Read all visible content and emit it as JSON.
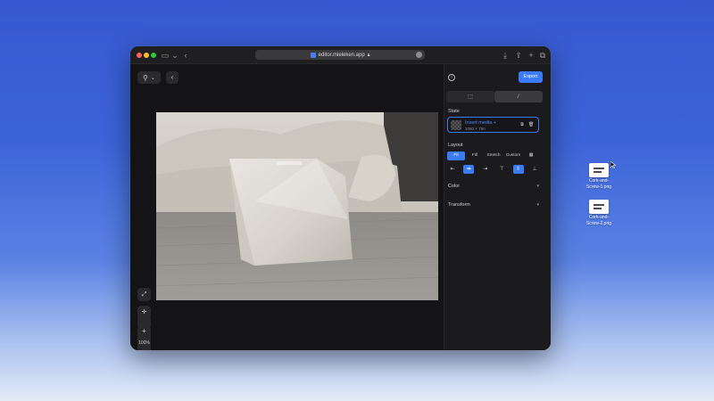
{
  "browser": {
    "url": "editor.mieleken.app",
    "icons": [
      "sidebar-icon",
      "chevron-down-icon",
      "back-icon",
      "lock-icon",
      "download-icon",
      "share-icon",
      "new-tab-icon",
      "tabs-icon"
    ]
  },
  "toolbar": {
    "tool_icon": "pin-icon",
    "tool_chevron": "chevron-down-icon",
    "back_icon": "back-icon"
  },
  "canvas": {
    "zoom_in": "+",
    "zoom_value": "100%",
    "zoom_out": "−",
    "side_icons": [
      "expand-icon",
      "center-icon"
    ]
  },
  "panel": {
    "export_label": "Export",
    "tab_icons": [
      "crop-icon",
      "magic-wand-icon"
    ],
    "state": {
      "label": "State",
      "media_name": "Insert media +",
      "media_size": "1080 × 750"
    },
    "layout": {
      "label": "Layout",
      "options": [
        "Fit",
        "Fill",
        "Stretch",
        "Custom"
      ],
      "active_option": "Fit"
    },
    "color_label": "Color",
    "transform_label": "Transform"
  },
  "desktop": {
    "files": [
      {
        "label_line1": "Cork-and-",
        "label_line2": "Screw-1.png"
      },
      {
        "label_line1": "Cork-and-",
        "label_line2": "Screw-2.png"
      }
    ]
  },
  "colors": {
    "accent": "#3b7bf5",
    "window_bg": "#1b1b1d",
    "canvas_bg": "#141416"
  }
}
